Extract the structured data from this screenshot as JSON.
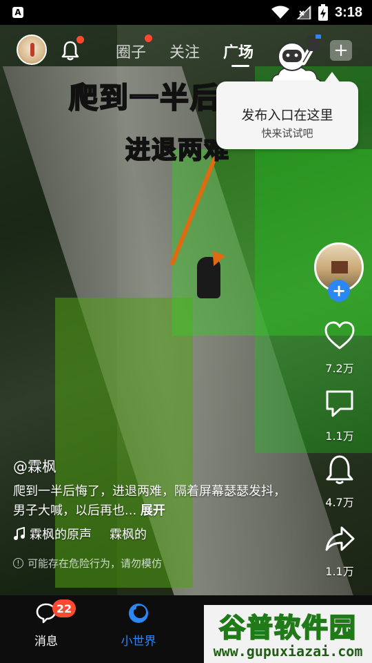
{
  "status_bar": {
    "app_icon_letter": "A",
    "time": "3:18"
  },
  "video": {
    "overlay_line1": "爬到一半后悔",
    "overlay_line2": "进退两难"
  },
  "top_nav": {
    "tabs": [
      {
        "label": "圈子",
        "active": false,
        "has_dot": true
      },
      {
        "label": "关注",
        "active": false,
        "has_dot": false
      },
      {
        "label": "广场",
        "active": true,
        "has_dot": false
      }
    ],
    "plus_label": "+"
  },
  "tooltip": {
    "title": "发布入口在这里",
    "subtitle": "快来试试吧"
  },
  "right_rail": {
    "follow_label": "+",
    "like_count": "7.2万",
    "comment_count": "1.1万",
    "bell_count": "4.7万",
    "share_count": "1.1万"
  },
  "post": {
    "author": "@霖枫",
    "description": "爬到一半后悔了，进退两难，隔着屏幕瑟瑟发抖，男子大喊，以后再也...",
    "expand_label": "展开",
    "music_1": "霖枫的原声",
    "music_2": "霖枫的",
    "warning": "可能存在危险行为，请勿模仿"
  },
  "bottom_nav": {
    "messages_label": "消息",
    "messages_badge": "22",
    "world_label": "小世界"
  },
  "watermark": {
    "line1": "谷普软件园",
    "line2": "www.gupuxiazai.com"
  },
  "colors": {
    "accent_blue": "#2b86f6",
    "badge_red": "#ff4a2f",
    "caption_yellow": "#ffea00",
    "caption_green": "#3cff3c"
  }
}
